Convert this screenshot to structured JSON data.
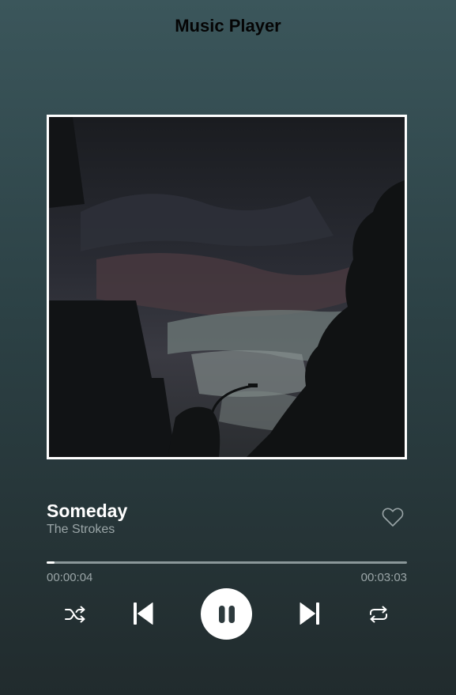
{
  "header": {
    "title": "Music Player"
  },
  "track": {
    "title": "Someday",
    "artist": "The Strokes",
    "favorite": false
  },
  "playback": {
    "current_time": "00:00:04",
    "total_time": "00:03:03",
    "progress_fraction": 0.022,
    "state": "playing"
  },
  "controls": {
    "shuffle_icon": "shuffle-icon",
    "previous_icon": "skip-previous-icon",
    "play_pause_icon": "pause-icon",
    "next_icon": "skip-next-icon",
    "repeat_icon": "repeat-icon"
  },
  "colors": {
    "accent": "#ffffff",
    "muted_text": "#9aa5a7",
    "bg_top": "#3b565b",
    "bg_bottom": "#212b2d"
  }
}
